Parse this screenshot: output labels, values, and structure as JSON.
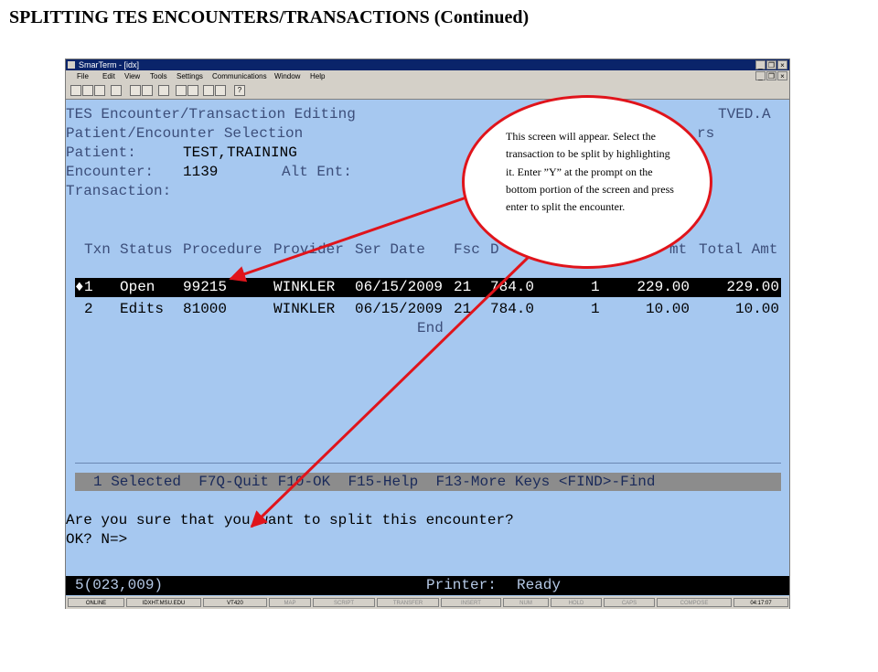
{
  "slide": {
    "title": "SPLITTING TES ENCOUNTERS/TRANSACTIONS (Continued)"
  },
  "window": {
    "title": "SmarTerm - [idx]",
    "menu": [
      "File",
      "Edit",
      "View",
      "Tools",
      "Settings",
      "Communications",
      "Window",
      "Help"
    ],
    "toolbar_help": "?"
  },
  "screen": {
    "header_left": "TES Encounter/Transaction Editing",
    "header_right": "TVED.A",
    "subheader": "Patient/Encounter Selection",
    "subheader_right": "rs",
    "patient_label": "Patient:",
    "patient_value": "TEST,TRAINING",
    "encounter_label": "Encounter:",
    "encounter_value": "1139",
    "alt_label": "Alt Ent:",
    "transaction_label": "Transaction:",
    "columns": {
      "txn": "Txn",
      "status": "Status",
      "procedure": "Procedure",
      "provider": "Provider",
      "ser_date": "Ser Date",
      "fsc": "Fsc",
      "dx": "D",
      "amt": "mt",
      "total_amt": "Total Amt"
    },
    "rows": [
      {
        "marker": "♦",
        "txn": "1",
        "status": "Open",
        "procedure": "99215",
        "provider": "WINKLER",
        "ser_date": "06/15/2009",
        "fsc": "21",
        "dx": "784.0",
        "qty": "1",
        "amt": "229.00",
        "total": "229.00"
      },
      {
        "marker": "",
        "txn": "2",
        "status": "Edits",
        "procedure": "81000",
        "provider": "WINKLER",
        "ser_date": "06/15/2009",
        "fsc": "21",
        "dx": "784.0",
        "qty": "1",
        "amt": "10.00",
        "total": "10.00"
      }
    ],
    "end_label": "End",
    "status_bar": "1 Selected  F7Q-Quit F10-OK  F15-Help  F13-More Keys <FIND>-Find",
    "prompt_line1": "Are you sure that you want to split this encounter?",
    "prompt_line2": "OK? N=>",
    "cursor_pos": "5(023,009)",
    "printer_label": "Printer:",
    "printer_status": "Ready"
  },
  "sysbar": [
    "ONLINE",
    "IDXHT.MSU.EDU",
    "VT420",
    "MAP",
    "SCRIPT",
    "TRANSFER",
    "INSERT",
    "NUM",
    "HOLD",
    "CAPS",
    "COMPOSE",
    "04:17:07"
  ],
  "callout": {
    "text": "This screen will appear. Select the transaction to be split by highlighting it. Enter ”Y” at the prompt on the bottom portion of the screen and press enter to split the encounter."
  },
  "colors": {
    "terminal_bg": "#a6c8f0",
    "highlight_row": "#000000",
    "callout_border": "#e0141b",
    "arrow": "#e0141b"
  }
}
